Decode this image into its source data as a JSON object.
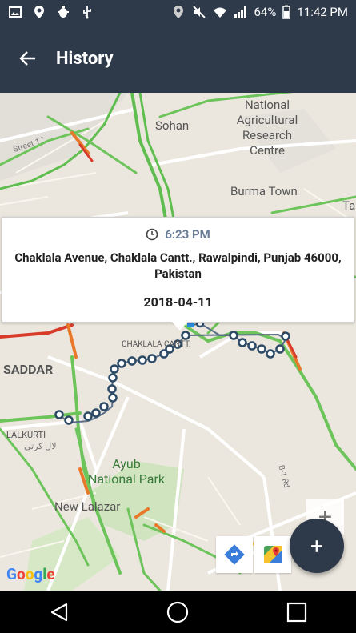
{
  "status_bar": {
    "battery": "64%",
    "time": "11:42 PM",
    "icons": [
      "image-icon",
      "location-pin-icon",
      "bug-icon",
      "usb-icon",
      "location-icon",
      "mute-icon",
      "wifi-icon",
      "signal-icon",
      "battery-icon"
    ]
  },
  "app_bar": {
    "title": "History",
    "back_icon": "arrow-left-icon"
  },
  "map": {
    "labels": {
      "sohan": "Sohan",
      "narc_1": "National",
      "narc_2": "Agricultural",
      "narc_3": "Research",
      "narc_4": "Centre",
      "burma_town": "Burma Town",
      "saddar": "SADDAR",
      "chaklala": "CHAKLALA CANTT.",
      "lalkurti": "LALKURTI",
      "lalkurti_urdu": "لال کرتی",
      "ayub_1": "Ayub",
      "ayub_2": "National Park",
      "new_lalazar": "New Lalazar",
      "street17": "Street 17",
      "b1rd": "B-1 Rd",
      "ta": "Ta"
    },
    "route_color": "#2c4a66"
  },
  "info_window": {
    "time": "6:23 PM",
    "address": "Chaklala Avenue, Chaklala Cantt., Rawalpindi, Punjab 46000, Pakistan",
    "date": "2018-04-11"
  },
  "controls": {
    "zoom_in": "+",
    "fab": "+",
    "google": [
      "G",
      "o",
      "o",
      "g",
      "l",
      "e"
    ]
  },
  "colors": {
    "app_bar": "#2e3a4a",
    "time_accent": "#6a7c96",
    "fab": "#2e3a4a"
  }
}
